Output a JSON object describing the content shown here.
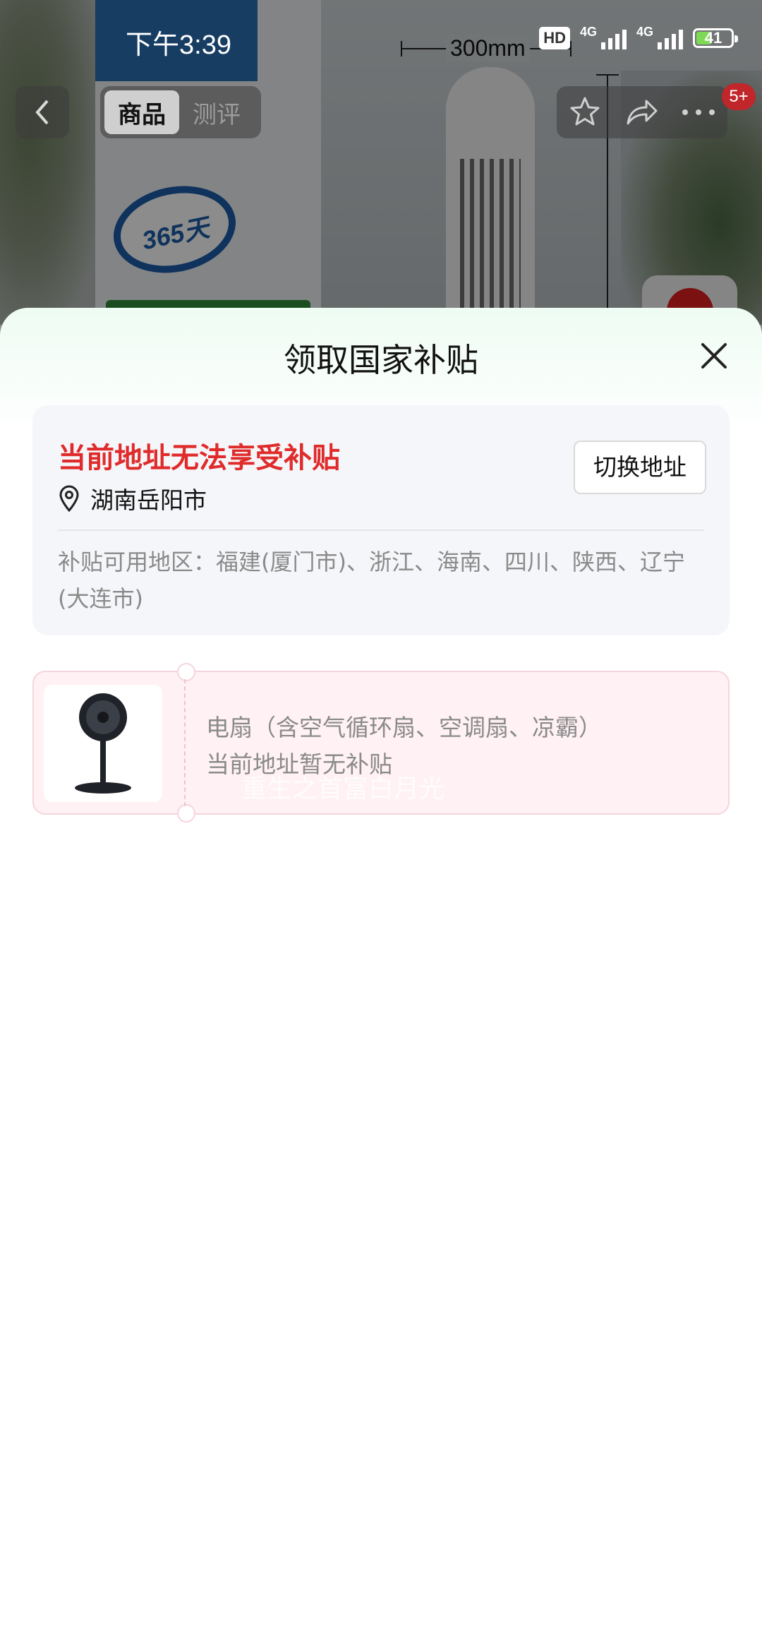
{
  "status_bar": {
    "time": "下午3:39",
    "hd": "HD",
    "network_1": "4G",
    "network_2": "4G",
    "battery": "41"
  },
  "background": {
    "dimension_label": "300mm",
    "logo_text": "365天"
  },
  "nav": {
    "tabs": [
      {
        "label": "商品",
        "active": true
      },
      {
        "label": "测评",
        "active": false
      }
    ],
    "badge": "5+"
  },
  "sheet": {
    "title": "领取国家补贴",
    "address_card": {
      "warning": "当前地址无法享受补贴",
      "location": "湖南岳阳市",
      "switch_button": "切换地址",
      "available_regions": "补贴可用地区：福建(厦门市)、浙江、海南、四川、陕西、辽宁(大连市)"
    },
    "product": {
      "name": "电扇（含空气循环扇、空调扇、凉霸）",
      "status": "当前地址暂无补贴"
    },
    "watermark": "重生之首富白月光"
  },
  "colors": {
    "warning_red": "#e02b2b",
    "sheet_header_tint": "#eefcf3",
    "product_card_bg": "#fff1f4"
  }
}
